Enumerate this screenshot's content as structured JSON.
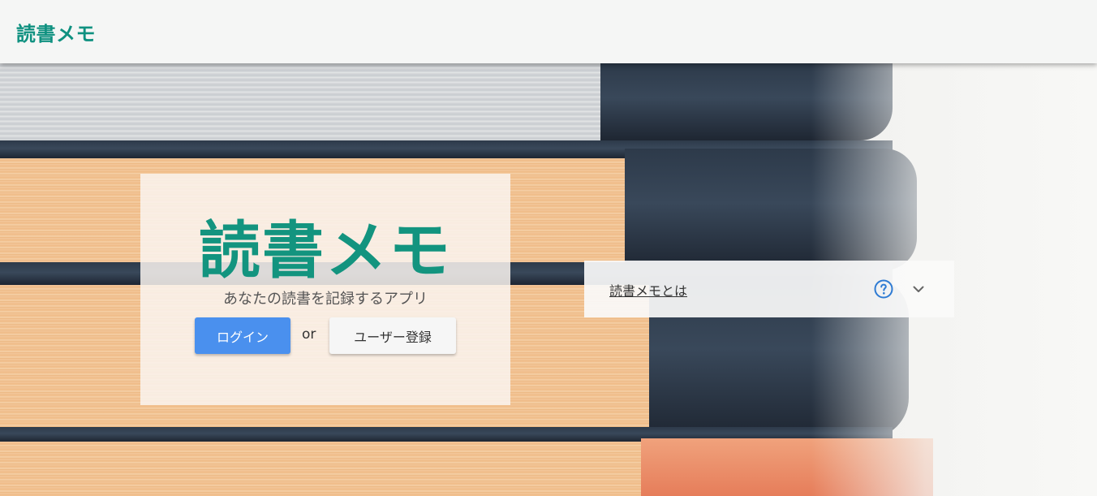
{
  "header": {
    "title": "読書メモ"
  },
  "hero": {
    "title": "読書メモ",
    "subtitle": "あなたの読書を記録するアプリ",
    "login_label": "ログイン",
    "or_text": "or",
    "signup_label": "ユーザー登録"
  },
  "about_panel": {
    "label": "読書メモとは",
    "help_icon": "help-circle-icon",
    "expand_icon": "chevron-down-icon"
  },
  "colors": {
    "brand": "#13947f",
    "primary_button": "#4a90ee",
    "help_icon": "#2f7bd3"
  }
}
